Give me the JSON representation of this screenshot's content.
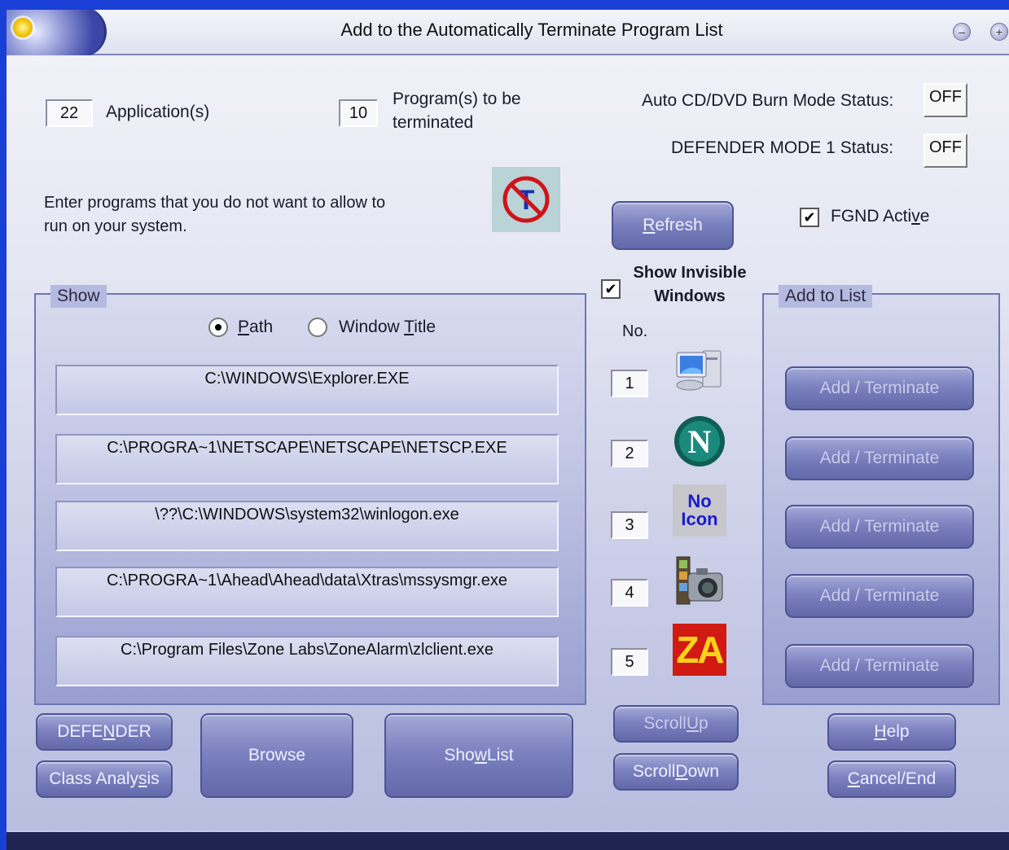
{
  "window": {
    "title": "Add to the Automatically Terminate Program List"
  },
  "counts": {
    "applications_value": "22",
    "applications_label": "Application(s)",
    "terminated_value": "10",
    "terminated_label_line1": "Program(s) to be",
    "terminated_label_line2": "terminated"
  },
  "status": {
    "burn_mode_label": "Auto CD/DVD Burn Mode Status:",
    "burn_mode_value": "OFF",
    "defender_label": "DEFENDER MODE 1 Status:",
    "defender_value": "OFF"
  },
  "instructions": {
    "line1": "Enter programs that you do not want to allow to",
    "line2": "run on your system."
  },
  "refresh_button": {
    "prefix": "",
    "hotkey": "R",
    "rest": "efresh"
  },
  "fgnd": {
    "checked": true,
    "prefix": "FGND Acti",
    "hotkey": "v",
    "rest": "e"
  },
  "show_invisible": {
    "checked": true,
    "line1": "Show Invisible",
    "line2": "Windows"
  },
  "show_group": {
    "title": "Show",
    "radio_path": {
      "prefix": "",
      "hotkey": "P",
      "rest": "ath",
      "selected": true
    },
    "radio_title": {
      "prefix": "Window ",
      "hotkey": "T",
      "rest": "itle",
      "selected": false
    }
  },
  "number_header": "No.",
  "entries": [
    {
      "no": "1",
      "path": "C:\\WINDOWS\\Explorer.EXE",
      "icon": "computer-icon"
    },
    {
      "no": "2",
      "path": "C:\\PROGRA~1\\NETSCAPE\\NETSCAPE\\NETSCP.EXE",
      "icon": "netscape-icon"
    },
    {
      "no": "3",
      "path": "\\??\\C:\\WINDOWS\\system32\\winlogon.exe",
      "icon": "no-icon-placeholder",
      "icon_text_line1": "No",
      "icon_text_line2": "Icon"
    },
    {
      "no": "4",
      "path": "C:\\PROGRA~1\\Ahead\\Ahead\\data\\Xtras\\mssysmgr.exe",
      "icon": "camera-icon"
    },
    {
      "no": "5",
      "path": "C:\\Program Files\\Zone Labs\\ZoneAlarm\\zlclient.exe",
      "icon": "zonealarm-icon",
      "icon_text": "ZA"
    }
  ],
  "add_group": {
    "title": "Add to List",
    "button_label": "Add / Terminate"
  },
  "bottom_buttons": {
    "defender": {
      "prefix": "DEFE",
      "hotkey": "N",
      "rest": "DER"
    },
    "class_analysis": {
      "prefix": "Class Analy",
      "hotkey": "s",
      "rest": "is"
    },
    "browse": "Browse",
    "show_list": {
      "prefix": "Sho",
      "hotkey": "w",
      "rest": " List"
    },
    "scroll_up": {
      "prefix": "Scroll ",
      "hotkey": "U",
      "rest": "p"
    },
    "scroll_down": {
      "prefix": "Scroll ",
      "hotkey": "D",
      "rest": "own"
    },
    "help": {
      "prefix": "",
      "hotkey": "H",
      "rest": "elp"
    },
    "cancel_end": {
      "prefix": "",
      "hotkey": "C",
      "rest": "ancel/End"
    }
  },
  "colors": {
    "desktop": "#1a3fd6",
    "button": "#7c82c0",
    "group_border": "#6f76b3"
  }
}
